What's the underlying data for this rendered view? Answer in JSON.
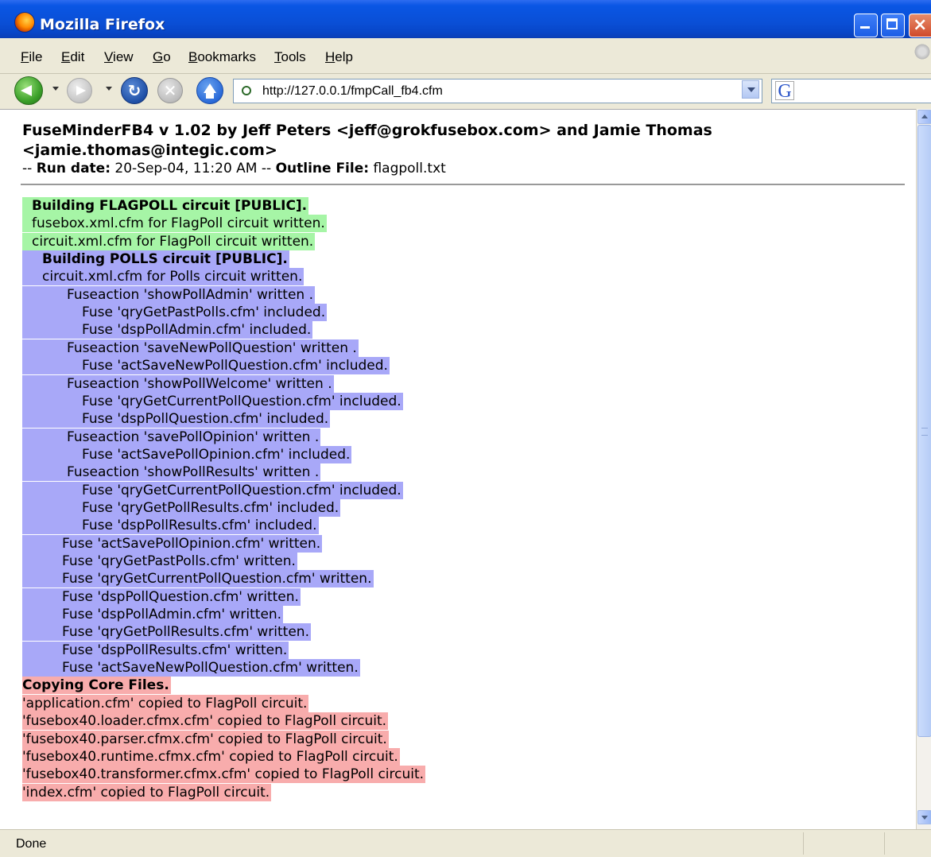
{
  "window": {
    "title": "Mozilla Firefox"
  },
  "menubar": {
    "items": [
      "File",
      "Edit",
      "View",
      "Go",
      "Bookmarks",
      "Tools",
      "Help"
    ]
  },
  "navbar": {
    "url": "http://127.0.0.1/fmpCall_fb4.cfm",
    "search_icon": "google-icon",
    "search_letter": "G"
  },
  "page": {
    "title": "FuseMinderFB4 v 1.02 by Jeff Peters <jeff@grokfusebox.com> and Jamie Thomas <jamie.thomas@integic.com>",
    "rundate_prefix": "-- ",
    "rundate_label": "Run date:",
    "rundate_value": " 20-Sep-04, 11:20 AM -- ",
    "outline_label": "Outline File:",
    "outline_value": " flagpoll.txt",
    "log_lines": [
      {
        "text": "Building FLAGPOLL circuit [PUBLIC].",
        "color": "green",
        "bold": true,
        "indent": 40
      },
      {
        "text": "fusebox.xml.cfm for FlagPoll circuit written.",
        "color": "green",
        "bold": false,
        "indent": 40
      },
      {
        "text": "circuit.xml.cfm for FlagPoll circuit written.",
        "color": "green",
        "bold": false,
        "indent": 40
      },
      {
        "text": "Building POLLS circuit [PUBLIC].",
        "color": "blue",
        "bold": true,
        "indent": 53
      },
      {
        "text": "circuit.xml.cfm for Polls circuit written.",
        "color": "blue",
        "bold": false,
        "indent": 53
      },
      {
        "text": "Fuseaction 'showPollAdmin' written .",
        "color": "blue",
        "bold": false,
        "indent": 84
      },
      {
        "text": "Fuse 'qryGetPastPolls.cfm' included.",
        "color": "blue",
        "bold": false,
        "indent": 103
      },
      {
        "text": "Fuse 'dspPollAdmin.cfm' included.",
        "color": "blue",
        "bold": false,
        "indent": 103
      },
      {
        "text": "Fuseaction 'saveNewPollQuestion' written .",
        "color": "blue",
        "bold": false,
        "indent": 84
      },
      {
        "text": "Fuse 'actSaveNewPollQuestion.cfm' included.",
        "color": "blue",
        "bold": false,
        "indent": 103
      },
      {
        "text": "Fuseaction 'showPollWelcome' written .",
        "color": "blue",
        "bold": false,
        "indent": 84
      },
      {
        "text": "Fuse 'qryGetCurrentPollQuestion.cfm' included.",
        "color": "blue",
        "bold": false,
        "indent": 103
      },
      {
        "text": "Fuse 'dspPollQuestion.cfm' included.",
        "color": "blue",
        "bold": false,
        "indent": 103
      },
      {
        "text": "Fuseaction 'savePollOpinion' written .",
        "color": "blue",
        "bold": false,
        "indent": 84
      },
      {
        "text": "Fuse 'actSavePollOpinion.cfm' included.",
        "color": "blue",
        "bold": false,
        "indent": 103
      },
      {
        "text": "Fuseaction 'showPollResults' written .",
        "color": "blue",
        "bold": false,
        "indent": 84
      },
      {
        "text": "Fuse 'qryGetCurrentPollQuestion.cfm' included.",
        "color": "blue",
        "bold": false,
        "indent": 103
      },
      {
        "text": "Fuse 'qryGetPollResults.cfm' included.",
        "color": "blue",
        "bold": false,
        "indent": 103
      },
      {
        "text": "Fuse 'dspPollResults.cfm' included.",
        "color": "blue",
        "bold": false,
        "indent": 103
      },
      {
        "text": "Fuse 'actSavePollOpinion.cfm' written.",
        "color": "blue",
        "bold": false,
        "indent": 78
      },
      {
        "text": "Fuse 'qryGetPastPolls.cfm' written.",
        "color": "blue",
        "bold": false,
        "indent": 78
      },
      {
        "text": "Fuse 'qryGetCurrentPollQuestion.cfm' written.",
        "color": "blue",
        "bold": false,
        "indent": 78
      },
      {
        "text": "Fuse 'dspPollQuestion.cfm' written.",
        "color": "blue",
        "bold": false,
        "indent": 78
      },
      {
        "text": "Fuse 'dspPollAdmin.cfm' written.",
        "color": "blue",
        "bold": false,
        "indent": 78
      },
      {
        "text": "Fuse 'qryGetPollResults.cfm' written.",
        "color": "blue",
        "bold": false,
        "indent": 78
      },
      {
        "text": "Fuse 'dspPollResults.cfm' written.",
        "color": "blue",
        "bold": false,
        "indent": 78
      },
      {
        "text": "Fuse 'actSaveNewPollQuestion.cfm' written.",
        "color": "blue",
        "bold": false,
        "indent": 78
      },
      {
        "text": "Copying Core Files.",
        "color": "red",
        "bold": true,
        "indent": 28
      },
      {
        "text": "'application.cfm' copied to FlagPoll circuit.",
        "color": "red",
        "bold": false,
        "indent": 28
      },
      {
        "text": "'fusebox40.loader.cfmx.cfm' copied to FlagPoll circuit.",
        "color": "red",
        "bold": false,
        "indent": 28
      },
      {
        "text": "'fusebox40.parser.cfmx.cfm' copied to FlagPoll circuit.",
        "color": "red",
        "bold": false,
        "indent": 28
      },
      {
        "text": "'fusebox40.runtime.cfmx.cfm' copied to FlagPoll circuit.",
        "color": "red",
        "bold": false,
        "indent": 28
      },
      {
        "text": "'fusebox40.transformer.cfmx.cfm' copied to FlagPoll circuit.",
        "color": "red",
        "bold": false,
        "indent": 28
      },
      {
        "text": "'index.cfm' copied to FlagPoll circuit.",
        "color": "red",
        "bold": false,
        "indent": 28
      }
    ]
  },
  "statusbar": {
    "text": "Done"
  },
  "colors": {
    "green": "#a6f5a6",
    "blue": "#a8a8f8",
    "red": "#f8acac",
    "titlebar": "#0a4fd6",
    "chrome": "#ece9d8"
  }
}
